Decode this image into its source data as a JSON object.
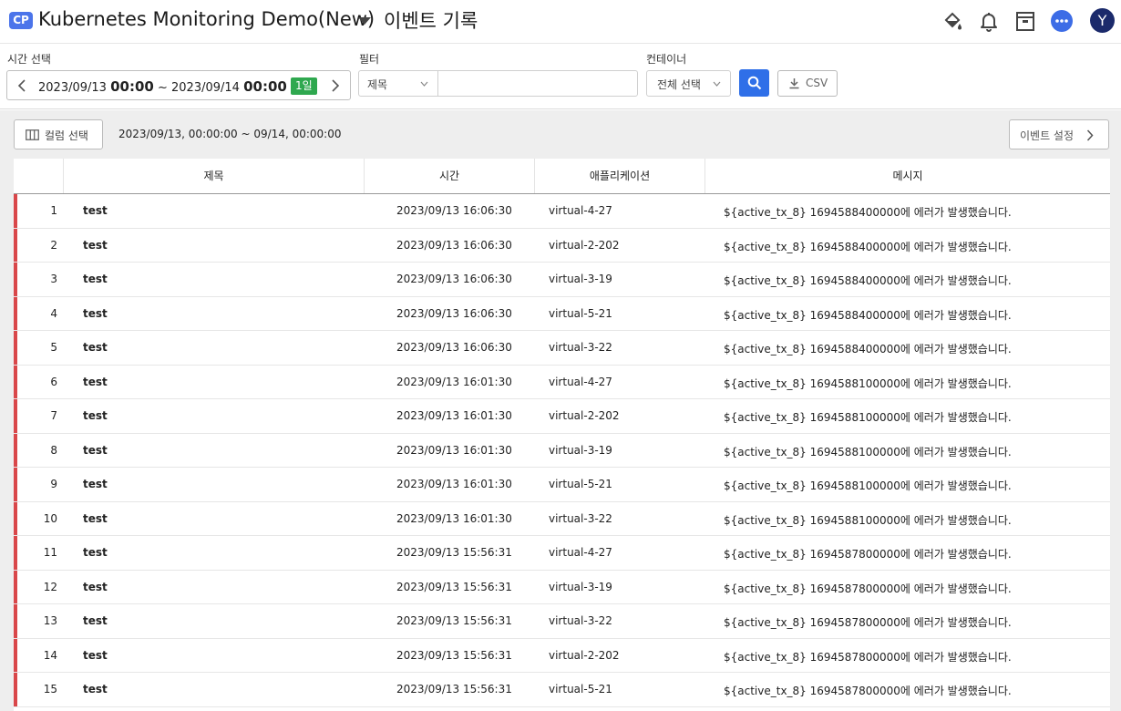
{
  "header": {
    "badge": "CP",
    "project_title": "Kubernetes Monitoring Demo(New)",
    "page_title": "이벤트 기록",
    "avatar_letter": "Y",
    "icons": [
      "paint-bucket-icon",
      "bell-icon",
      "archive-icon",
      "chat-icon"
    ]
  },
  "filters": {
    "time_label": "시간 선택",
    "start_date": "2023/09/13",
    "start_time": "00:00",
    "separator": "~",
    "end_date": "2023/09/14",
    "end_time": "00:00",
    "duration_badge": "1일",
    "filter_label": "필터",
    "filter_select": "제목",
    "filter_value": "",
    "container_label": "컨테이너",
    "container_select": "전체 선택",
    "csv_label": "CSV"
  },
  "toolbar": {
    "column_select": "컬럼 선택",
    "range_text": "2023/09/13, 00:00:00 ~ 09/14, 00:00:00",
    "event_settings": "이벤트 설정"
  },
  "table": {
    "columns": [
      "제목",
      "시간",
      "애플리케이션",
      "메시지"
    ],
    "rows": [
      {
        "idx": "1",
        "title": "test",
        "time": "2023/09/13 16:06:30",
        "app": "virtual-4-27",
        "msg": "${active_tx_8} 1694588400000에 에러가 발생했습니다."
      },
      {
        "idx": "2",
        "title": "test",
        "time": "2023/09/13 16:06:30",
        "app": "virtual-2-202",
        "msg": "${active_tx_8} 1694588400000에 에러가 발생했습니다."
      },
      {
        "idx": "3",
        "title": "test",
        "time": "2023/09/13 16:06:30",
        "app": "virtual-3-19",
        "msg": "${active_tx_8} 1694588400000에 에러가 발생했습니다."
      },
      {
        "idx": "4",
        "title": "test",
        "time": "2023/09/13 16:06:30",
        "app": "virtual-5-21",
        "msg": "${active_tx_8} 1694588400000에 에러가 발생했습니다."
      },
      {
        "idx": "5",
        "title": "test",
        "time": "2023/09/13 16:06:30",
        "app": "virtual-3-22",
        "msg": "${active_tx_8} 1694588400000에 에러가 발생했습니다."
      },
      {
        "idx": "6",
        "title": "test",
        "time": "2023/09/13 16:01:30",
        "app": "virtual-4-27",
        "msg": "${active_tx_8} 1694588100000에 에러가 발생했습니다."
      },
      {
        "idx": "7",
        "title": "test",
        "time": "2023/09/13 16:01:30",
        "app": "virtual-2-202",
        "msg": "${active_tx_8} 1694588100000에 에러가 발생했습니다."
      },
      {
        "idx": "8",
        "title": "test",
        "time": "2023/09/13 16:01:30",
        "app": "virtual-3-19",
        "msg": "${active_tx_8} 1694588100000에 에러가 발생했습니다."
      },
      {
        "idx": "9",
        "title": "test",
        "time": "2023/09/13 16:01:30",
        "app": "virtual-5-21",
        "msg": "${active_tx_8} 1694588100000에 에러가 발생했습니다."
      },
      {
        "idx": "10",
        "title": "test",
        "time": "2023/09/13 16:01:30",
        "app": "virtual-3-22",
        "msg": "${active_tx_8} 1694588100000에 에러가 발생했습니다."
      },
      {
        "idx": "11",
        "title": "test",
        "time": "2023/09/13 15:56:31",
        "app": "virtual-4-27",
        "msg": "${active_tx_8} 1694587800000에 에러가 발생했습니다."
      },
      {
        "idx": "12",
        "title": "test",
        "time": "2023/09/13 15:56:31",
        "app": "virtual-3-19",
        "msg": "${active_tx_8} 1694587800000에 에러가 발생했습니다."
      },
      {
        "idx": "13",
        "title": "test",
        "time": "2023/09/13 15:56:31",
        "app": "virtual-3-22",
        "msg": "${active_tx_8} 1694587800000에 에러가 발생했습니다."
      },
      {
        "idx": "14",
        "title": "test",
        "time": "2023/09/13 15:56:31",
        "app": "virtual-2-202",
        "msg": "${active_tx_8} 1694587800000에 에러가 발생했습니다."
      },
      {
        "idx": "15",
        "title": "test",
        "time": "2023/09/13 15:56:31",
        "app": "virtual-5-21",
        "msg": "${active_tx_8} 1694587800000에 에러가 발생했습니다."
      }
    ]
  },
  "colors": {
    "accent": "#2f6fe8",
    "badge_blue": "#4b74ea",
    "duration_green": "#2fa84f",
    "row_marker_red": "#d9474a",
    "avatar": "#1b2a6b"
  }
}
